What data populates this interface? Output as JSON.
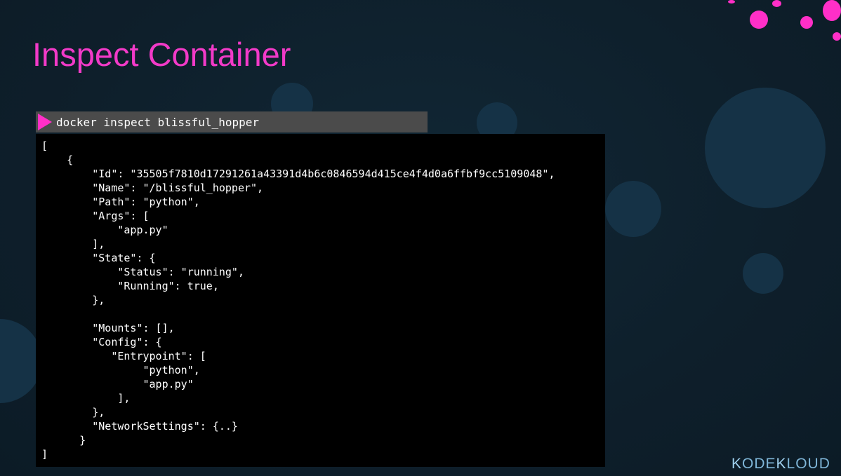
{
  "slide": {
    "title": "Inspect Container",
    "logo": {
      "k1": "K",
      "text1": "ODE",
      "k2": "K",
      "text2": "LOUD"
    }
  },
  "terminal": {
    "prompt_icon": "play-triangle-icon",
    "command": "docker inspect blissful_hopper",
    "output_lines": [
      "[",
      "    {",
      "        \"Id\": \"35505f7810d17291261a43391d4b6c0846594d415ce4f4d0a6ffbf9cc5109048\",",
      "        \"Name\": \"/blissful_hopper\",",
      "        \"Path\": \"python\",",
      "        \"Args\": [",
      "            \"app.py\"",
      "        ],",
      "        \"State\": {",
      "            \"Status\": \"running\",",
      "            \"Running\": true,",
      "        },",
      "",
      "        \"Mounts\": [],",
      "        \"Config\": {",
      "           \"Entrypoint\": [",
      "                \"python\",",
      "                \"app.py\"",
      "            ],",
      "        },",
      "        \"NetworkSettings\": {..}",
      "      }",
      "]"
    ]
  },
  "colors": {
    "accent": "#f23ac8",
    "background": "#0f202d",
    "terminal_bg": "#000000",
    "command_bar_bg": "#4b4b4b",
    "logo": "#7fb6d8"
  }
}
